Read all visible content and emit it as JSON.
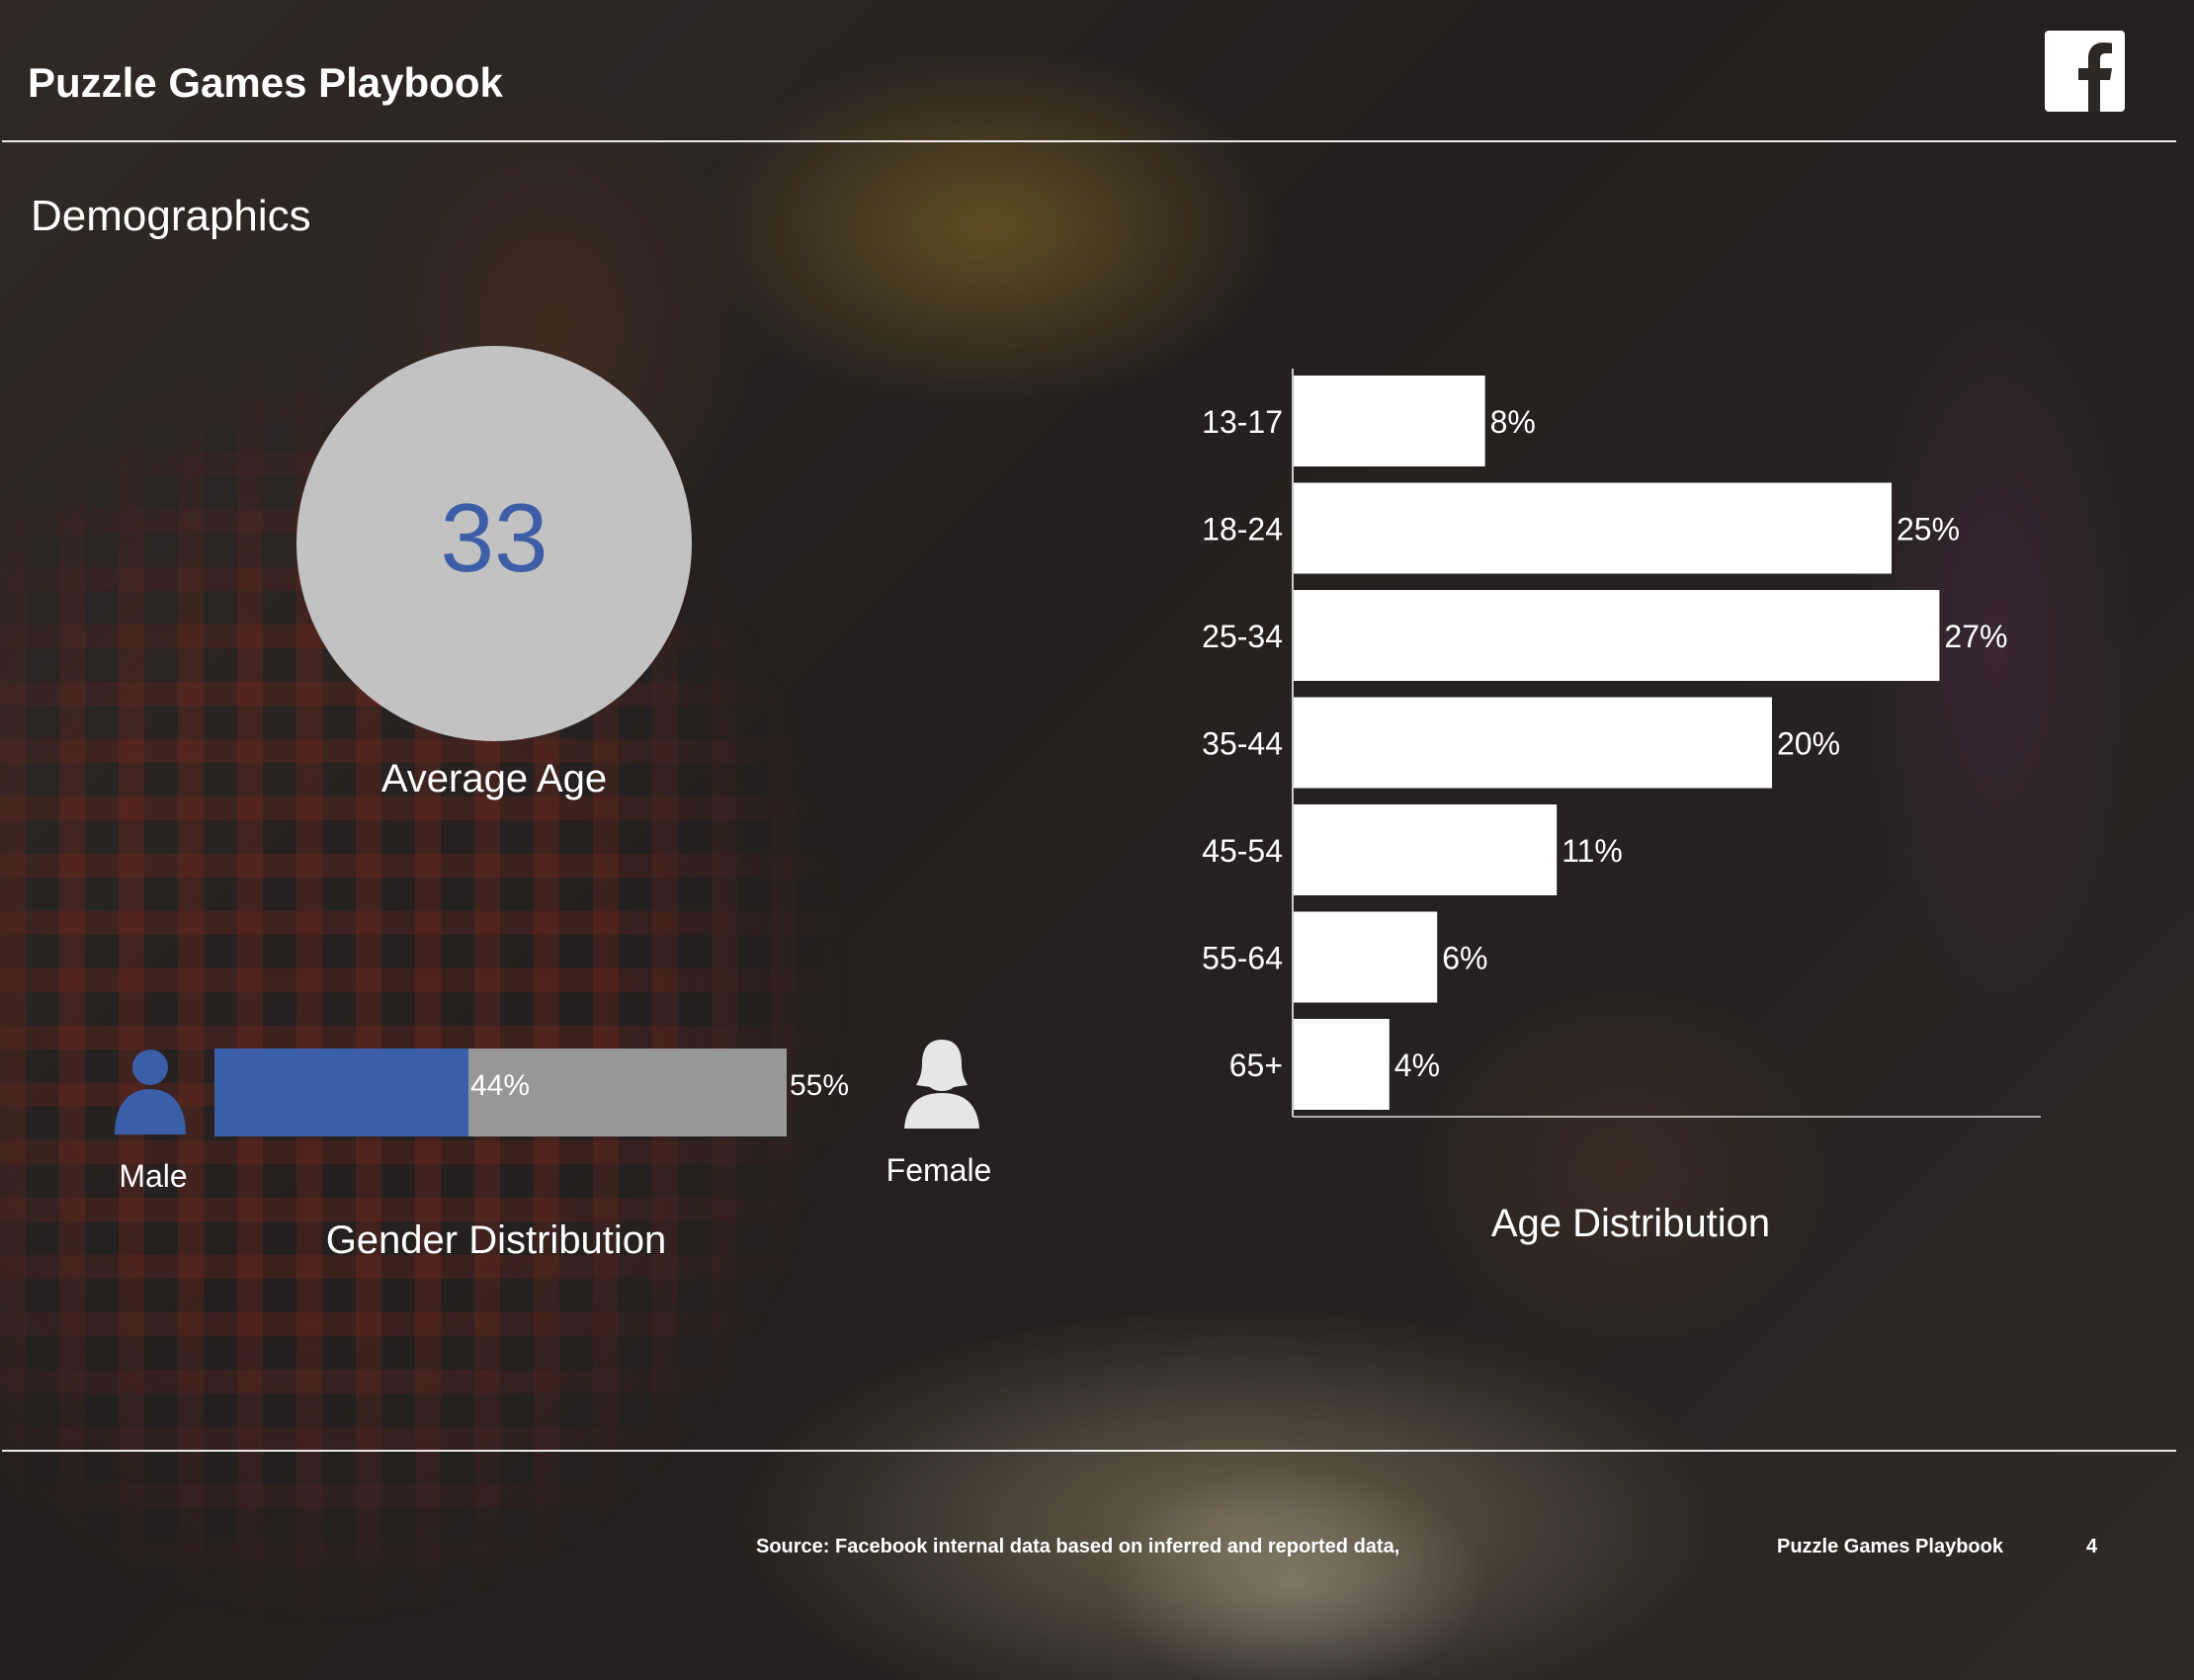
{
  "header": {
    "title": "Puzzle Games Playbook",
    "logo_icon": "facebook-logo-icon"
  },
  "section": {
    "title": "Demographics"
  },
  "average_age": {
    "value": "33",
    "label": "Average Age"
  },
  "gender": {
    "male": {
      "label": "Male",
      "percent_label": "44%",
      "icon": "male-person-icon"
    },
    "female": {
      "label": "Female",
      "percent_label": "55%",
      "icon": "female-person-icon"
    },
    "title": "Gender Distribution"
  },
  "age_chart": {
    "title": "Age Distribution"
  },
  "footer": {
    "source": "Source: Facebook internal data based on inferred and reported data,",
    "brand": "Puzzle Games Playbook",
    "page": "4"
  },
  "colors": {
    "male": "#3b5ea8",
    "female": "#979797",
    "circle": "#c2c2c2",
    "accent_text": "#3d5ea6",
    "bar": "#ffffff"
  },
  "chart_data": [
    {
      "type": "bar",
      "orientation": "horizontal",
      "title": "Age Distribution",
      "categories": [
        "13-17",
        "18-24",
        "25-34",
        "35-44",
        "45-54",
        "55-64",
        "65+"
      ],
      "values": [
        8,
        25,
        27,
        20,
        11,
        6,
        4
      ],
      "value_labels": [
        "8%",
        "25%",
        "27%",
        "20%",
        "11%",
        "6%",
        "4%"
      ],
      "unit": "%",
      "grid": false
    },
    {
      "type": "bar",
      "orientation": "horizontal",
      "stacked": true,
      "title": "Gender Distribution",
      "categories": [
        "Male",
        "Female"
      ],
      "values": [
        44,
        55
      ],
      "value_labels": [
        "44%",
        "55%"
      ],
      "unit": "%"
    }
  ]
}
